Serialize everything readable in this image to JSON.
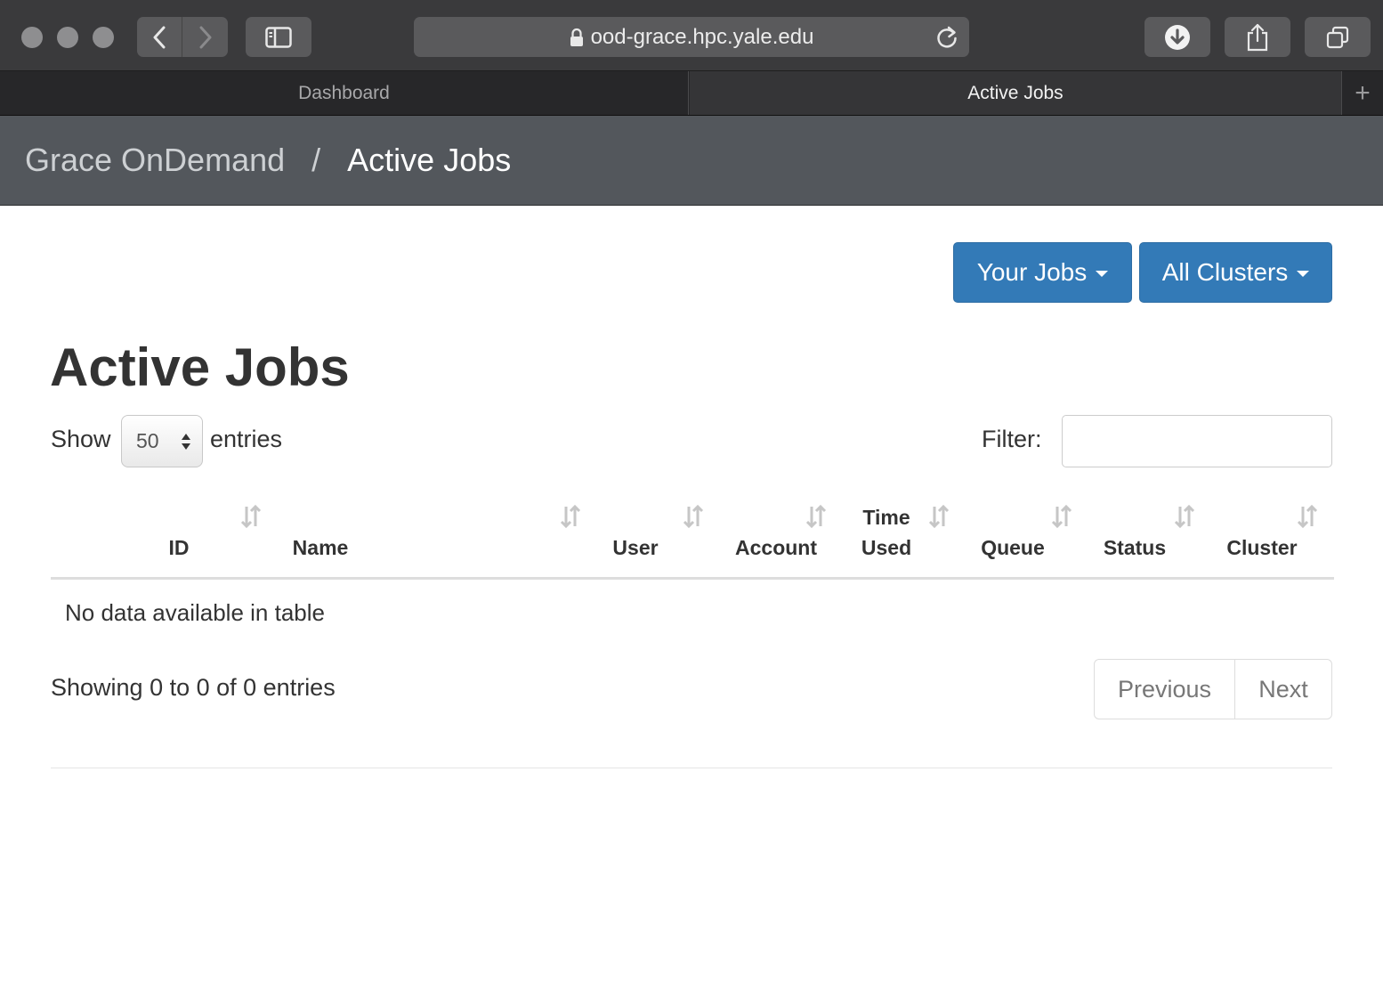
{
  "browser": {
    "url": "ood-grace.hpc.yale.edu",
    "tabs": [
      {
        "label": "Dashboard",
        "active": false
      },
      {
        "label": "Active Jobs",
        "active": true
      }
    ],
    "new_tab_label": "+"
  },
  "navbar": {
    "brand": "Grace OnDemand",
    "separator": "/",
    "current": "Active Jobs"
  },
  "filters": {
    "jobs_button": "Your Jobs",
    "clusters_button": "All Clusters"
  },
  "main": {
    "title": "Active Jobs",
    "show_label": "Show",
    "page_size": "50",
    "entries_label": "entries",
    "filter_label": "Filter:",
    "filter_value": ""
  },
  "table": {
    "columns": [
      {
        "line1": "",
        "line2": "ID"
      },
      {
        "line1": "",
        "line2": "Name"
      },
      {
        "line1": "",
        "line2": "User"
      },
      {
        "line1": "",
        "line2": "Account"
      },
      {
        "line1": "Time",
        "line2": "Used"
      },
      {
        "line1": "",
        "line2": "Queue"
      },
      {
        "line1": "",
        "line2": "Status"
      },
      {
        "line1": "",
        "line2": "Cluster"
      }
    ],
    "empty_message": "No data available in table"
  },
  "pagination": {
    "info": "Showing 0 to 0 of 0 entries",
    "previous": "Previous",
    "next": "Next"
  },
  "colors": {
    "primary": "#337ab7",
    "navbar": "#53575c"
  }
}
